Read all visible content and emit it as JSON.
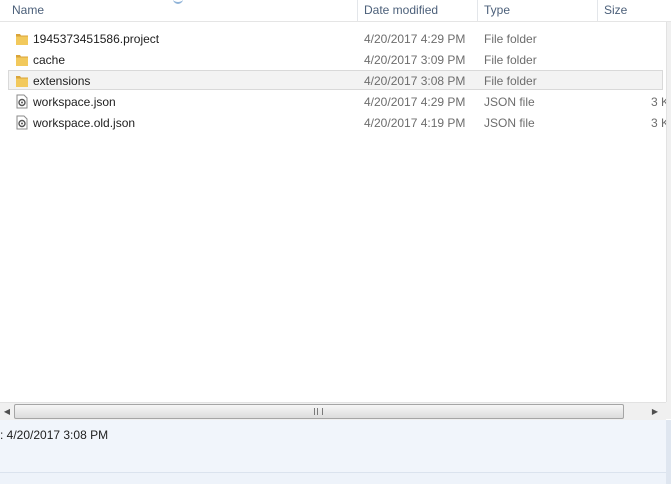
{
  "columns": {
    "name": "Name",
    "date": "Date modified",
    "type": "Type",
    "size": "Size"
  },
  "files": [
    {
      "name": "1945373451586.project",
      "date": "4/20/2017 4:29 PM",
      "type": "File folder",
      "size": "",
      "icon": "folder-icon",
      "selected": false
    },
    {
      "name": "cache",
      "date": "4/20/2017 3:09 PM",
      "type": "File folder",
      "size": "",
      "icon": "folder-icon",
      "selected": false
    },
    {
      "name": "extensions",
      "date": "4/20/2017 3:08 PM",
      "type": "File folder",
      "size": "",
      "icon": "folder-icon",
      "selected": true
    },
    {
      "name": "workspace.json",
      "date": "4/20/2017 4:29 PM",
      "type": "JSON file",
      "size": "3 K",
      "icon": "json-file-icon",
      "selected": false
    },
    {
      "name": "workspace.old.json",
      "date": "4/20/2017 4:19 PM",
      "type": "JSON file",
      "size": "3 K",
      "icon": "json-file-icon",
      "selected": false
    }
  ],
  "details": {
    "text": ": 4/20/2017 3:08 PM"
  },
  "scrollbar": {
    "left_arrow": "◀",
    "right_arrow": "▶"
  },
  "colors": {
    "folder": "#e8b84a",
    "header_text": "#4c607a",
    "selection": "#f3f3f3"
  }
}
